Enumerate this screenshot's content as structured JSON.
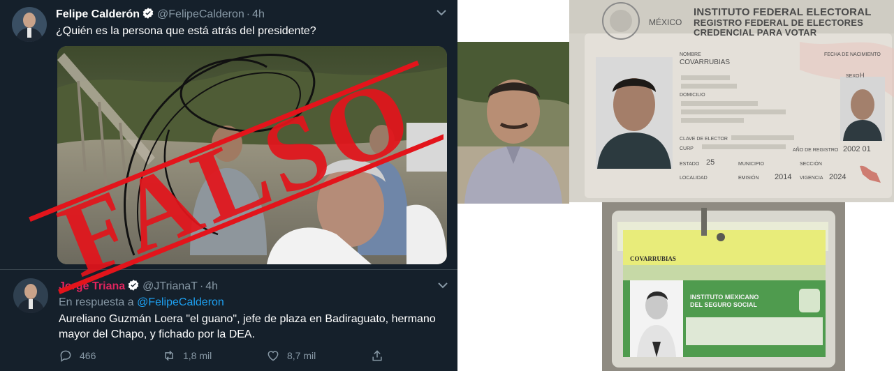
{
  "tweet1": {
    "author_name": "Felipe Calderón",
    "handle": "@FelipeCalderon",
    "separator": "·",
    "time": "4h",
    "text": "¿Quién es la persona que está atrás del presidente?",
    "stamp_text": "FALSO"
  },
  "tweet2": {
    "author_name": "Jorge Triana",
    "handle": "@JTrianaT",
    "separator": "·",
    "time": "4h",
    "reply_prefix": "En respuesta a",
    "reply_to": "@FelipeCalderon",
    "text": "Aureliano Guzmán Loera \"el guano\", jefe de plaza en Badiraguato, hermano mayor del Chapo, y fichado por la DEA.",
    "actions": {
      "replies": "466",
      "retweets": "1,8 mil",
      "likes": "8,7 mil"
    }
  },
  "ine_card": {
    "country": "MÉXICO",
    "institute": "INSTITUTO FEDERAL ELECTORAL",
    "registry": "REGISTRO FEDERAL DE ELECTORES",
    "credential": "CREDENCIAL PARA VOTAR",
    "name_label": "NOMBRE",
    "surname": "COVARRUBIAS",
    "address_label": "DOMICILIO",
    "birth_label": "FECHA DE NACIMIENTO",
    "sex_label": "SEXO",
    "sex_value": "H",
    "elector_label": "CLAVE DE ELECTOR",
    "curp_label": "CURP",
    "reg_year_label": "AÑO DE REGISTRO",
    "reg_year_value": "2002 01",
    "state_label": "ESTADO",
    "state_value": "25",
    "municipality_label": "MUNICIPIO",
    "section_label": "SECCIÓN",
    "locality_label": "LOCALIDAD",
    "emission_label": "EMISIÓN",
    "emission_value": "2014",
    "validity_label": "VIGENCIA",
    "validity_value": "2024"
  },
  "imss_card": {
    "surname": "COVARRUBIAS",
    "institute_line1": "INSTITUTO MEXICANO",
    "institute_line2": "DEL SEGURO SOCIAL"
  },
  "colors": {
    "tweet_bg": "#15202b",
    "stamp_red": "#e3141b",
    "link_blue": "#1da1f2",
    "muted": "#8899a6"
  }
}
